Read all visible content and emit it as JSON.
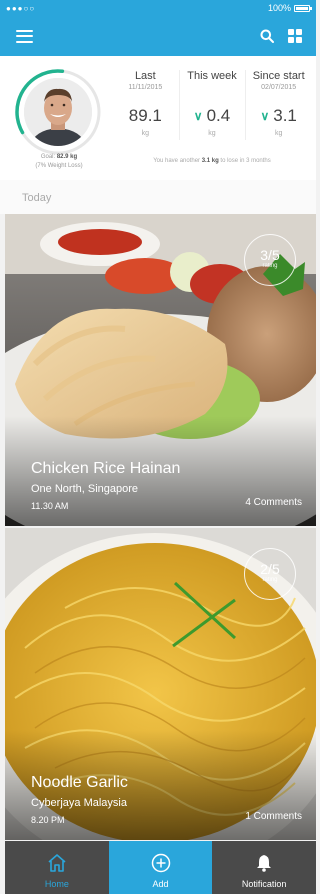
{
  "status_bar": {
    "carrier_dots": "●●●○○",
    "battery": "100%",
    "battery_level": 1.0
  },
  "appbar": {
    "icons": [
      "menu-icon",
      "search-icon",
      "grid-icon"
    ]
  },
  "stats": {
    "progress_fraction": 0.35,
    "goal_label": "Goal:",
    "goal_value": "82.9 kg",
    "goal_sub": "(7% Weight Loss)",
    "columns": [
      {
        "title": "Last",
        "date": "11/11/2015",
        "value": "89.1",
        "unit": "kg",
        "trend": ""
      },
      {
        "title": "This week",
        "date": "",
        "value": "0.4",
        "unit": "kg",
        "trend": "down"
      },
      {
        "title": "Since start",
        "date": "02/07/2015",
        "value": "3.1",
        "unit": "kg",
        "trend": "down"
      }
    ],
    "note_prefix": "You have another",
    "note_value": "3.1 kg",
    "note_suffix": "to lose in 3 months"
  },
  "section": {
    "title": "Today"
  },
  "cards": [
    {
      "title": "Chicken Rice Hainan",
      "location": "One North, Singapore",
      "time": "11.30 AM",
      "comments": "4 Comments",
      "rating": "3/5",
      "rating_label": "rating"
    },
    {
      "title": "Noodle Garlic",
      "location": "Cyberjaya Malaysia",
      "time": "8.20 PM",
      "comments": "1 Comments",
      "rating": "2/5",
      "rating_label": "rating"
    }
  ],
  "tabs": [
    {
      "label": "Home",
      "icon": "home-icon"
    },
    {
      "label": "Add",
      "icon": "add-circle-icon"
    },
    {
      "label": "Notification",
      "icon": "bell-icon"
    }
  ],
  "colors": {
    "primary": "#2aa6db",
    "accent_green": "#22b38f",
    "tabbar": "#4a4a4a"
  }
}
